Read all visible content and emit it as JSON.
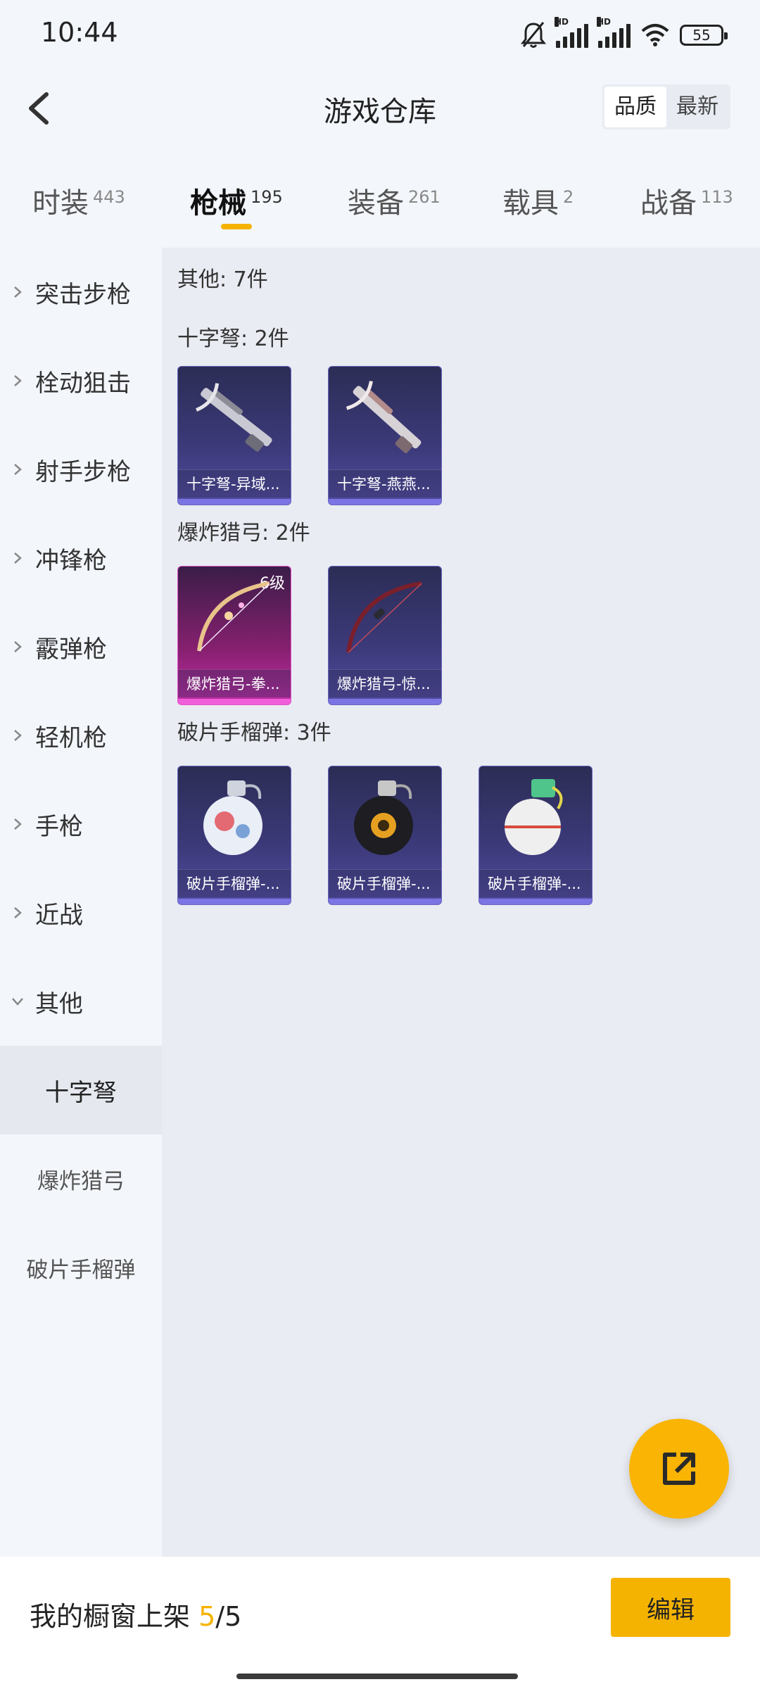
{
  "status": {
    "time": "10:44",
    "battery": "55"
  },
  "header": {
    "title": "游戏仓库",
    "sort_quality": "品质",
    "sort_latest": "最新"
  },
  "tabs": [
    {
      "label": "时装",
      "count": "443"
    },
    {
      "label": "枪械",
      "count": "195"
    },
    {
      "label": "装备",
      "count": "261"
    },
    {
      "label": "载具",
      "count": "2"
    },
    {
      "label": "战备",
      "count": "113"
    }
  ],
  "sidebar": {
    "categories": [
      "突击步枪",
      "栓动狙击",
      "射手步枪",
      "冲锋枪",
      "霰弹枪",
      "轻机枪",
      "手枪",
      "近战",
      "其他"
    ],
    "subcategories": [
      "十字弩",
      "爆炸猎弓",
      "破片手榴弹"
    ]
  },
  "main": {
    "group_title": "其他: 7件",
    "sections": [
      {
        "title": "十字弩: 2件",
        "items": [
          "十字弩-异域...",
          "十字弩-燕燕..."
        ]
      },
      {
        "title": "爆炸猎弓: 2件",
        "items": [
          "爆炸猎弓-拳...",
          "爆炸猎弓-惊..."
        ],
        "level": "6级"
      },
      {
        "title": "破片手榴弹: 3件",
        "items": [
          "破片手榴弹-...",
          "破片手榴弹-...",
          "破片手榴弹-..."
        ]
      }
    ]
  },
  "bottom": {
    "shelf_label": "我的橱窗上架",
    "shelf_current": "5",
    "shelf_total": "/5",
    "edit_label": "编辑"
  },
  "colors": {
    "accent": "#f5b301",
    "card_blue": "#3d3a7b",
    "card_pink": "#c72ea9"
  },
  "icons": [
    "bell-mute-icon",
    "signal-icon",
    "wifi-icon",
    "battery-icon",
    "back-arrow-icon",
    "chevron-right-icon",
    "chevron-down-icon",
    "share-external-icon"
  ]
}
